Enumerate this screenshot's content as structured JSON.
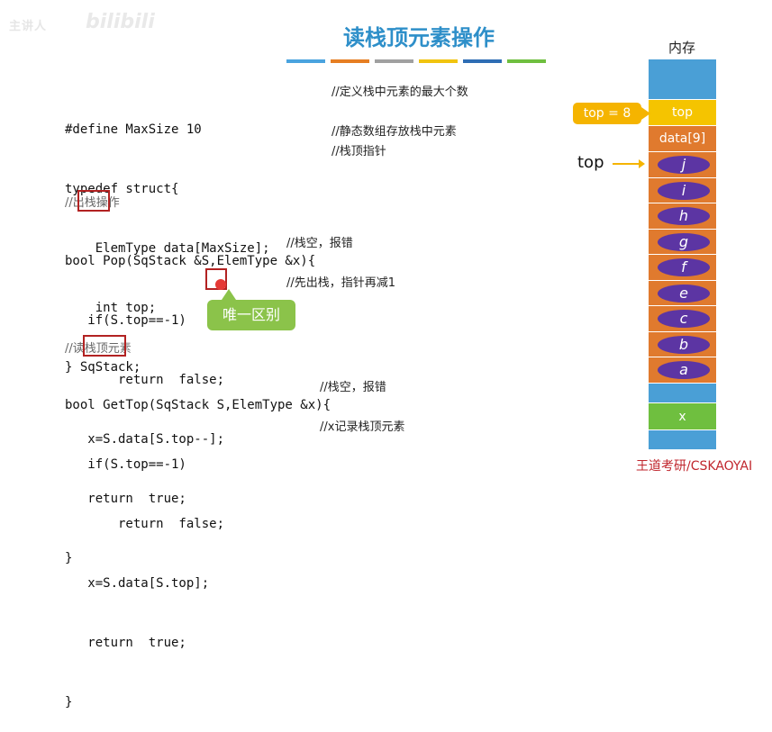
{
  "watermark": {
    "text1": "主讲人",
    "text2": "bilibili"
  },
  "title": "读栈顶元素操作",
  "colorbar": [
    "#4aa3df",
    "#e67e22",
    "#a0a0a0",
    "#f1c40f",
    "#2e6db4",
    "#6fbf3f"
  ],
  "code1": {
    "l1": "#define MaxSize 10",
    "l2": "typedef struct{",
    "l3": "    ElemType data[MaxSize];",
    "l4": "    int top;",
    "l5": "} SqStack;",
    "c1": "//定义栈中元素的最大个数",
    "c2": "//静态数组存放栈中元素",
    "c3": "//栈顶指针"
  },
  "pop": {
    "comment": "//出栈操作",
    "l1": "bool Pop(SqStack &S,ElemType &x){",
    "l2": "   if(S.top==-1)",
    "l3": "       return  false;",
    "l4": "   x=S.data[S.top--];",
    "l5": "   return  true;",
    "l6": "}",
    "c1": "//栈空，报错",
    "c2": "//先出栈，指针再减1"
  },
  "callout": "唯一区别",
  "gettop": {
    "comment": "//读栈顶元素",
    "l1": "bool GetTop(SqStack S,ElemType &x){",
    "l2": "   if(S.top==-1)",
    "l3": "       return  false;",
    "l4": "   x=S.data[S.top];",
    "l5": "   return  true;",
    "l6": "}",
    "c1": "//栈空，报错",
    "c2": "//x记录栈顶元素"
  },
  "memory": {
    "title": "内存",
    "top_cell": "top",
    "data9": "data[9]",
    "elements": [
      "j",
      "i",
      "h",
      "g",
      "f",
      "e",
      "c",
      "b",
      "a"
    ],
    "x_cell": "x",
    "colors": {
      "blue": "#4a9fd6",
      "yellow": "#f5c400",
      "orange": "#e07a2e",
      "purple": "#5c35a3",
      "green": "#6fbf3f"
    }
  },
  "top_callout": "top = 8",
  "top_pointer": "top",
  "brand": "王道考研/CSKAOYAI"
}
